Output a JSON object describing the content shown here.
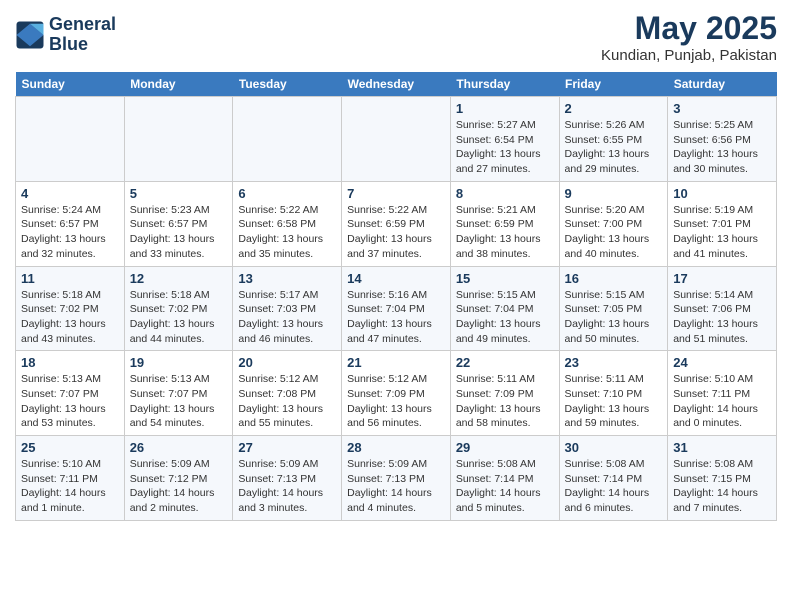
{
  "header": {
    "logo_line1": "General",
    "logo_line2": "Blue",
    "title": "May 2025",
    "subtitle": "Kundian, Punjab, Pakistan"
  },
  "days_of_week": [
    "Sunday",
    "Monday",
    "Tuesday",
    "Wednesday",
    "Thursday",
    "Friday",
    "Saturday"
  ],
  "weeks": [
    [
      {
        "day": "",
        "info": ""
      },
      {
        "day": "",
        "info": ""
      },
      {
        "day": "",
        "info": ""
      },
      {
        "day": "",
        "info": ""
      },
      {
        "day": "1",
        "info": "Sunrise: 5:27 AM\nSunset: 6:54 PM\nDaylight: 13 hours and 27 minutes."
      },
      {
        "day": "2",
        "info": "Sunrise: 5:26 AM\nSunset: 6:55 PM\nDaylight: 13 hours and 29 minutes."
      },
      {
        "day": "3",
        "info": "Sunrise: 5:25 AM\nSunset: 6:56 PM\nDaylight: 13 hours and 30 minutes."
      }
    ],
    [
      {
        "day": "4",
        "info": "Sunrise: 5:24 AM\nSunset: 6:57 PM\nDaylight: 13 hours and 32 minutes."
      },
      {
        "day": "5",
        "info": "Sunrise: 5:23 AM\nSunset: 6:57 PM\nDaylight: 13 hours and 33 minutes."
      },
      {
        "day": "6",
        "info": "Sunrise: 5:22 AM\nSunset: 6:58 PM\nDaylight: 13 hours and 35 minutes."
      },
      {
        "day": "7",
        "info": "Sunrise: 5:22 AM\nSunset: 6:59 PM\nDaylight: 13 hours and 37 minutes."
      },
      {
        "day": "8",
        "info": "Sunrise: 5:21 AM\nSunset: 6:59 PM\nDaylight: 13 hours and 38 minutes."
      },
      {
        "day": "9",
        "info": "Sunrise: 5:20 AM\nSunset: 7:00 PM\nDaylight: 13 hours and 40 minutes."
      },
      {
        "day": "10",
        "info": "Sunrise: 5:19 AM\nSunset: 7:01 PM\nDaylight: 13 hours and 41 minutes."
      }
    ],
    [
      {
        "day": "11",
        "info": "Sunrise: 5:18 AM\nSunset: 7:02 PM\nDaylight: 13 hours and 43 minutes."
      },
      {
        "day": "12",
        "info": "Sunrise: 5:18 AM\nSunset: 7:02 PM\nDaylight: 13 hours and 44 minutes."
      },
      {
        "day": "13",
        "info": "Sunrise: 5:17 AM\nSunset: 7:03 PM\nDaylight: 13 hours and 46 minutes."
      },
      {
        "day": "14",
        "info": "Sunrise: 5:16 AM\nSunset: 7:04 PM\nDaylight: 13 hours and 47 minutes."
      },
      {
        "day": "15",
        "info": "Sunrise: 5:15 AM\nSunset: 7:04 PM\nDaylight: 13 hours and 49 minutes."
      },
      {
        "day": "16",
        "info": "Sunrise: 5:15 AM\nSunset: 7:05 PM\nDaylight: 13 hours and 50 minutes."
      },
      {
        "day": "17",
        "info": "Sunrise: 5:14 AM\nSunset: 7:06 PM\nDaylight: 13 hours and 51 minutes."
      }
    ],
    [
      {
        "day": "18",
        "info": "Sunrise: 5:13 AM\nSunset: 7:07 PM\nDaylight: 13 hours and 53 minutes."
      },
      {
        "day": "19",
        "info": "Sunrise: 5:13 AM\nSunset: 7:07 PM\nDaylight: 13 hours and 54 minutes."
      },
      {
        "day": "20",
        "info": "Sunrise: 5:12 AM\nSunset: 7:08 PM\nDaylight: 13 hours and 55 minutes."
      },
      {
        "day": "21",
        "info": "Sunrise: 5:12 AM\nSunset: 7:09 PM\nDaylight: 13 hours and 56 minutes."
      },
      {
        "day": "22",
        "info": "Sunrise: 5:11 AM\nSunset: 7:09 PM\nDaylight: 13 hours and 58 minutes."
      },
      {
        "day": "23",
        "info": "Sunrise: 5:11 AM\nSunset: 7:10 PM\nDaylight: 13 hours and 59 minutes."
      },
      {
        "day": "24",
        "info": "Sunrise: 5:10 AM\nSunset: 7:11 PM\nDaylight: 14 hours and 0 minutes."
      }
    ],
    [
      {
        "day": "25",
        "info": "Sunrise: 5:10 AM\nSunset: 7:11 PM\nDaylight: 14 hours and 1 minute."
      },
      {
        "day": "26",
        "info": "Sunrise: 5:09 AM\nSunset: 7:12 PM\nDaylight: 14 hours and 2 minutes."
      },
      {
        "day": "27",
        "info": "Sunrise: 5:09 AM\nSunset: 7:13 PM\nDaylight: 14 hours and 3 minutes."
      },
      {
        "day": "28",
        "info": "Sunrise: 5:09 AM\nSunset: 7:13 PM\nDaylight: 14 hours and 4 minutes."
      },
      {
        "day": "29",
        "info": "Sunrise: 5:08 AM\nSunset: 7:14 PM\nDaylight: 14 hours and 5 minutes."
      },
      {
        "day": "30",
        "info": "Sunrise: 5:08 AM\nSunset: 7:14 PM\nDaylight: 14 hours and 6 minutes."
      },
      {
        "day": "31",
        "info": "Sunrise: 5:08 AM\nSunset: 7:15 PM\nDaylight: 14 hours and 7 minutes."
      }
    ]
  ]
}
